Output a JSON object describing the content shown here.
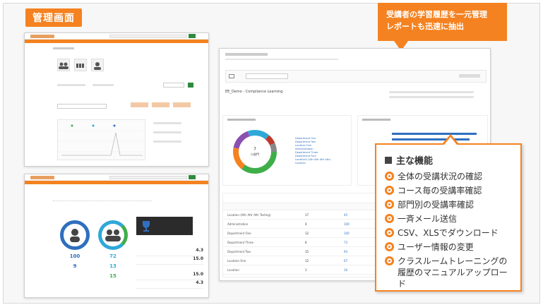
{
  "header": {
    "title": "管理画面"
  },
  "callout": {
    "line1": "受講者の学習履歴を一元管理",
    "line2": "レポートも迅速に抽出"
  },
  "features": {
    "title": "主な機能",
    "items": [
      "全体の受講状況の確認",
      "コース毎の受講率確認",
      "部門別の受講率確認",
      "一斉メール送信",
      "CSV、XLSでダウンロード",
      "ユーザー情報の変更",
      "クラスルームトレーニングの\n履歴のマニュアルアップロード"
    ]
  },
  "dept_screen": {
    "course_title": "EE_Demo - Compliance Learning",
    "donut_center_value": "7",
    "donut_center_label": "小部門",
    "legend": [
      "Department One",
      "Department Two",
      "Location One",
      "Administration",
      "Department Three",
      "Department Four",
      "Location2 (Attr Attr Attr Attr)",
      "Location"
    ],
    "table_rows": [
      {
        "name": "Location (Attr Attr Attr Testing)",
        "a": "17",
        "b": "45"
      },
      {
        "name": "Administration",
        "a": "4",
        "b": "100"
      },
      {
        "name": "Department One",
        "a": "12",
        "b": "100"
      },
      {
        "name": "Department Three",
        "a": "6",
        "b": "73"
      },
      {
        "name": "Department Two",
        "a": "15",
        "b": "93"
      },
      {
        "name": "Location One",
        "a": "12",
        "b": "67"
      },
      {
        "name": "Location",
        "a": "1",
        "b": "16"
      }
    ]
  },
  "overview_screen": {
    "stat1_value": "100",
    "stat1_sub": "9",
    "stat2_value": "72",
    "stat2_sub1": "13",
    "stat2_sub2": "15",
    "pct1": "4.3",
    "pct2": "15.0",
    "pct3": "15.0",
    "pct4": "4.3"
  },
  "colors": {
    "accent": "#f58220",
    "go_button": "#2e8b3d",
    "chart_blue": "#2f6fbf"
  }
}
